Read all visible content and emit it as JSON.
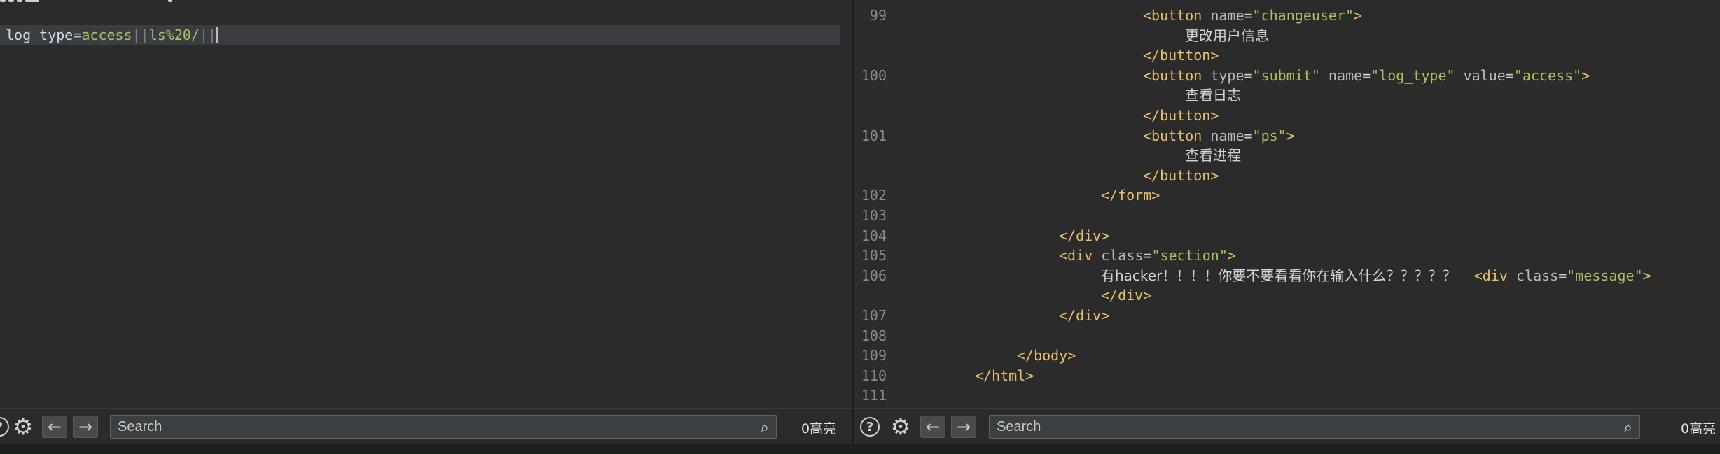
{
  "request_editor": {
    "line": {
      "key": "log_type",
      "op": "=",
      "val1": "access",
      "pipe1": "||",
      "val2": "ls%20/",
      "pipe2": "||"
    }
  },
  "response_view": {
    "lines": [
      {
        "num": "99",
        "parts": [
          {
            "t": "tag",
            "v": "<button "
          },
          {
            "t": "attr",
            "v": "name"
          },
          {
            "t": "eq",
            "v": "="
          },
          {
            "t": "str",
            "v": "\"changeuser\""
          },
          {
            "t": "tag",
            "v": ">"
          }
        ]
      },
      {
        "num": "",
        "parts": [
          {
            "t": "plain",
            "v": "更改用户信息"
          }
        ]
      },
      {
        "num": "",
        "parts": [
          {
            "t": "tag",
            "v": "</button>"
          }
        ]
      },
      {
        "num": "100",
        "parts": [
          {
            "t": "tag",
            "v": "<button "
          },
          {
            "t": "attr",
            "v": "type"
          },
          {
            "t": "eq",
            "v": "="
          },
          {
            "t": "str",
            "v": "\"submit\""
          },
          {
            "t": "attr",
            "v": " name"
          },
          {
            "t": "eq",
            "v": "="
          },
          {
            "t": "str",
            "v": "\"log_type\""
          },
          {
            "t": "attr",
            "v": " value"
          },
          {
            "t": "eq",
            "v": "="
          },
          {
            "t": "str",
            "v": "\"access\""
          },
          {
            "t": "tag",
            "v": ">"
          }
        ]
      },
      {
        "num": "",
        "parts": [
          {
            "t": "plain",
            "v": "查看日志"
          }
        ]
      },
      {
        "num": "",
        "parts": [
          {
            "t": "tag",
            "v": "</button>"
          }
        ]
      },
      {
        "num": "101",
        "parts": [
          {
            "t": "tag",
            "v": "<button "
          },
          {
            "t": "attr",
            "v": "name"
          },
          {
            "t": "eq",
            "v": "="
          },
          {
            "t": "str",
            "v": "\"ps\""
          },
          {
            "t": "tag",
            "v": ">"
          }
        ]
      },
      {
        "num": "",
        "parts": [
          {
            "t": "plain",
            "v": "查看进程"
          }
        ]
      },
      {
        "num": "",
        "parts": [
          {
            "t": "tag",
            "v": "</button>"
          }
        ]
      },
      {
        "num": "102",
        "parts": [
          {
            "t": "tag",
            "v": "</form>"
          }
        ]
      },
      {
        "num": "103",
        "parts": []
      },
      {
        "num": "104",
        "parts": [
          {
            "t": "tag",
            "v": "</div>"
          }
        ]
      },
      {
        "num": "105",
        "parts": [
          {
            "t": "tag",
            "v": "<div "
          },
          {
            "t": "attr",
            "v": "class"
          },
          {
            "t": "eq",
            "v": "="
          },
          {
            "t": "str",
            "v": "\"section\""
          },
          {
            "t": "tag",
            "v": ">"
          }
        ]
      },
      {
        "num": "106",
        "parts": [
          {
            "t": "plain",
            "v": "有hacker！！！！你要不要看看你在输入什么？？？？？    "
          },
          {
            "t": "tag",
            "v": "<div "
          },
          {
            "t": "attr",
            "v": "class"
          },
          {
            "t": "eq",
            "v": "="
          },
          {
            "t": "str",
            "v": "\"message\""
          },
          {
            "t": "tag",
            "v": ">"
          }
        ]
      },
      {
        "num": "",
        "parts": [
          {
            "t": "tag",
            "v": "</div>"
          }
        ]
      },
      {
        "num": "107",
        "parts": [
          {
            "t": "tag",
            "v": "</div>"
          }
        ]
      },
      {
        "num": "108",
        "parts": []
      },
      {
        "num": "109",
        "parts": [
          {
            "t": "tag",
            "v": "</body>"
          }
        ]
      },
      {
        "num": "110",
        "parts": [
          {
            "t": "tag",
            "v": "</html>"
          }
        ]
      },
      {
        "num": "111",
        "parts": []
      }
    ]
  },
  "left_toolbar": {
    "help_icon": "help-icon",
    "settings_icon": "gear-icon",
    "search_placeholder": "Search",
    "search_value": "",
    "hits_label": "0高亮"
  },
  "right_toolbar": {
    "help_icon": "help-icon",
    "settings_icon": "gear-icon",
    "search_placeholder": "Search",
    "search_value": "",
    "hits_label": "0高亮"
  }
}
